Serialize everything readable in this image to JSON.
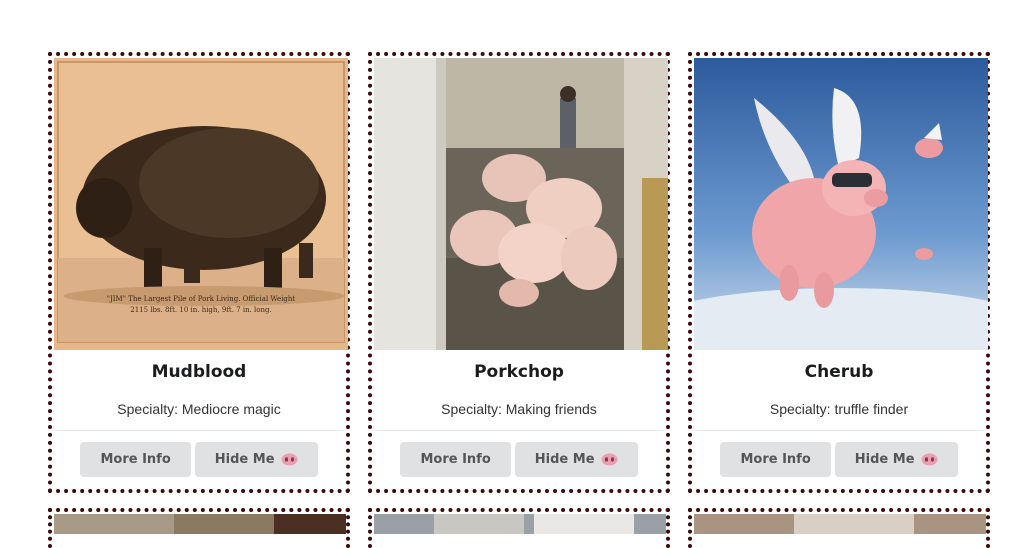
{
  "cards": [
    {
      "name": "Mudblood",
      "specialty": "Specialty: Mediocre magic",
      "more_info": "More Info",
      "hide_me": "Hide Me",
      "photo_caption": "\"JIM\" The Largest Pile of Pork Living. Official Weight 2115 lbs. 8ft. 10 in. high, 9ft. 7 in. long."
    },
    {
      "name": "Porkchop",
      "specialty": "Specialty: Making friends",
      "more_info": "More Info",
      "hide_me": "Hide Me"
    },
    {
      "name": "Cherub",
      "specialty": "Specialty: truffle finder",
      "more_info": "More Info",
      "hide_me": "Hide Me"
    }
  ],
  "colors": {
    "border": "#3b0a0a",
    "button_bg": "#e0e1e2",
    "pig_icon": "#e8a0b0"
  },
  "icons": {
    "hide_button_icon": "pig-nose-icon"
  }
}
